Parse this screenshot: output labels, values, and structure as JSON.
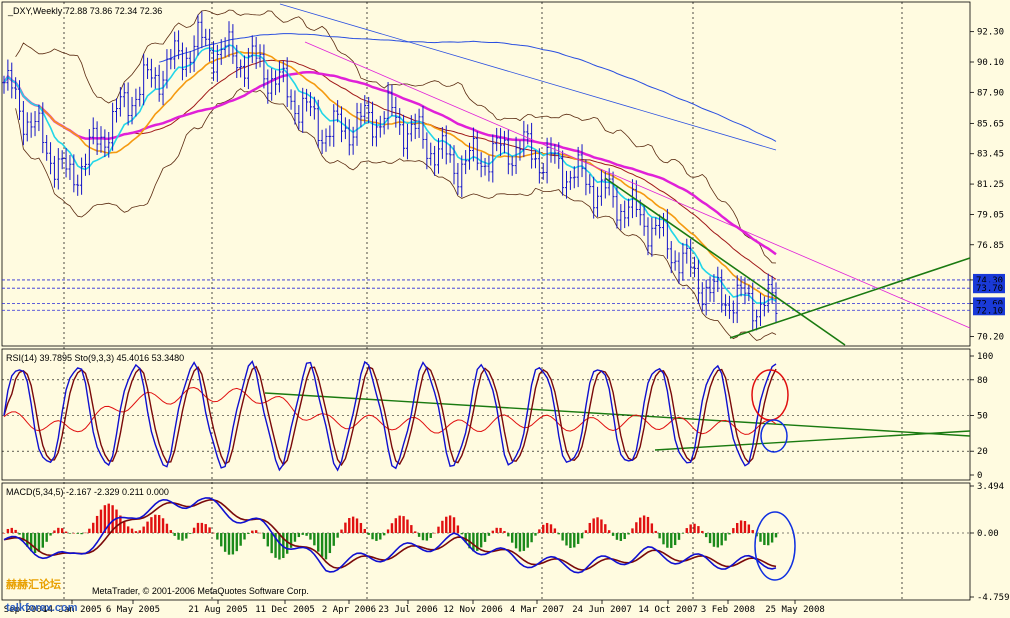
{
  "colors": {
    "background": "#fffbe0",
    "bar": "#1414c8",
    "ma_cyan": "#22d6e8",
    "ma_orange": "#f59a10",
    "ma_magenta": "#e020d8",
    "ma_blue_long": "#2a4fe0",
    "ma_dark_red": "#a01818",
    "ma_brown": "#8b3a1a",
    "bands": "#5a2a10",
    "trend_green": "#1a7a10",
    "price_level_line": "#2a2ad8",
    "rsi": "#e01010",
    "stoch_main": "#1010d0",
    "stoch_signal": "#7a0a0a",
    "macd_main": "#1010d0",
    "macd_signal": "#7a0a0a",
    "hist_pos": "#e01010",
    "hist_neg": "#1a8a1a",
    "annotation_red": "#e01010",
    "annotation_blue": "#1030e0",
    "dotted_vertical": "#000000"
  },
  "main_pane": {
    "title": "_DXY,Weekly  72.88 73.86 72.34 72.36",
    "y_ticks": [
      "92.30",
      "90.10",
      "87.90",
      "85.65",
      "83.45",
      "81.25",
      "79.05",
      "76.85",
      "74.30",
      "72.60",
      "70.20"
    ],
    "price_levels": [
      "74.30",
      "73.70",
      "72.60",
      "72.10"
    ],
    "price_level_labels_highlight": [
      "74.30",
      "73.70",
      "72.60",
      "72.10"
    ]
  },
  "rsi_pane": {
    "title": "RSI(14) 39.7895  Sto(9,3,3) 45.4016 53.3480",
    "y_ticks": [
      "100",
      "80",
      "50",
      "20",
      "0"
    ]
  },
  "macd_pane": {
    "title": "MACD(5,34,5) -2.167 -2.329 0.211 0.000",
    "y_ticks": [
      "3.494",
      "0.00",
      "-4.759"
    ]
  },
  "x_ticks": [
    "2 Sep 2004",
    "14 Jan 2005",
    "6 May 2005",
    "21 Aug 2005",
    "11 Dec 2005",
    "2 Apr 2006",
    "23 Jul 2006",
    "12 Nov 2006",
    "4 Mar 2007",
    "24 Jun 2007",
    "14 Oct 2007",
    "3 Feb 2008",
    "25 May 2008"
  ],
  "footer": {
    "watermark_cn": "赫赫汇论坛",
    "watermark_site": "talkforex.com",
    "copyright": "MetaTrader, © 2001-2006 MetaQuotes Software Corp."
  },
  "chart_data": [
    {
      "type": "line",
      "title": "_DXY,Weekly  72.88 73.86 72.34 72.36",
      "x": [
        "2 Sep 2004",
        "14 Jan 2005",
        "6 May 2005",
        "21 Aug 2005",
        "11 Dec 2005",
        "2 Apr 2006",
        "23 Jul 2006",
        "12 Nov 2006",
        "4 Mar 2007",
        "24 Jun 2007",
        "14 Oct 2007",
        "3 Feb 2008",
        "25 May 2008"
      ],
      "ylim": [
        69.5,
        93.5
      ],
      "series": [
        {
          "values": [
            88.6,
            81.5,
            87.8,
            91.5,
            89.8,
            85.0,
            86.3,
            82.6,
            84.0,
            81.6,
            78.5,
            73.2,
            72.4
          ]
        }
      ],
      "grid": false
    },
    {
      "type": "line",
      "title": "RSI(14) 39.7895  Sto(9,3,3) 45.4016 53.3480",
      "ylim": [
        0,
        100
      ],
      "series": [
        {
          "values": [
            49,
            38,
            62,
            68,
            66,
            45,
            44,
            40,
            46,
            42,
            45,
            40,
            40
          ]
        },
        {
          "values": [
            45,
            75,
            90,
            85,
            40,
            80,
            30,
            85,
            25,
            70,
            85,
            45,
            45
          ]
        },
        {
          "values": [
            45,
            70,
            85,
            82,
            45,
            75,
            35,
            80,
            30,
            65,
            80,
            55,
            53
          ]
        }
      ]
    },
    {
      "type": "bar",
      "title": "MACD(5,34,5) -2.167 -2.329 0.211 0.000",
      "ylim": [
        -4.759,
        3.494
      ],
      "series": [
        {
          "values": [
            -0.5,
            -2.0,
            1.5,
            2.5,
            0.5,
            -2.5,
            -1.5,
            -0.5,
            -2.0,
            -2.5,
            -1.5,
            -2.2,
            -2.167
          ]
        },
        {
          "values": [
            -0.3,
            -1.8,
            1.2,
            2.3,
            0.8,
            -2.0,
            -1.7,
            -0.8,
            -1.8,
            -2.3,
            -1.8,
            -2.4,
            -2.329
          ]
        }
      ]
    }
  ]
}
